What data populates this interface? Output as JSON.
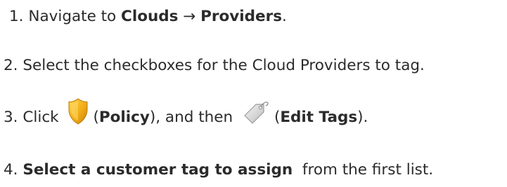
{
  "steps": [
    {
      "number": "1.",
      "text_a": "Navigate to ",
      "clouds": "Clouds",
      "arrow": " → ",
      "providers": "Providers",
      "period": "."
    },
    {
      "number": "2.",
      "text": "Select the checkboxes for the Cloud Providers to tag."
    },
    {
      "number": "3.",
      "text_a": "Click ",
      "paren_open_1": "(",
      "policy": "Policy",
      "text_b": "), and then ",
      "paren_open_2": "(",
      "edit_tags": "Edit Tags",
      "paren_close_2": ").",
      "icon_policy": "shield-icon",
      "icon_tag": "tag-icon"
    },
    {
      "number": "4.",
      "bold": "Select a customer tag to assign",
      "text": "  from the first list."
    }
  ],
  "colors": {
    "text": "#2b2b2b",
    "shield_gold": "#e8a317",
    "tag_gray": "#d9d9d9"
  }
}
